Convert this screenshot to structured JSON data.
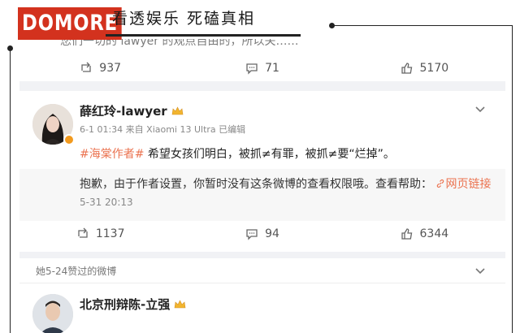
{
  "brand": {
    "logo": "DOMORE",
    "slogan": "看透娱乐  死磕真相"
  },
  "post_prev": {
    "cut_text": "您们一切的 lawyer 的观点自由的，所以关……",
    "reposts": "937",
    "comments": "71",
    "likes": "5170"
  },
  "post_main": {
    "author": "薛红玲-lawyer",
    "meta": "6-1 01:34 来自 Xiaomi 13 Ultra 已编辑",
    "hashtag": "#海棠作者#",
    "text": " 希望女孩们明白，被抓≠有罪，被抓≠要“烂掉”。",
    "inner_text": "抱歉，由于作者设置，你暂时没有这条微博的查看权限哦。查看帮助：",
    "inner_link": "网页链接",
    "inner_time": "5-31 20:13",
    "reposts": "1137",
    "comments": "94",
    "likes": "6344"
  },
  "post_next": {
    "section_label": "她5-24赞过的微博",
    "author": "北京刑辩陈-立强"
  },
  "colors": {
    "accent": "#eb7350",
    "brand_red": "#d3321e",
    "verify": "#f29a1e"
  },
  "icons": [
    "repost-icon",
    "comment-icon",
    "like-icon",
    "chevron-down-icon",
    "crown-icon",
    "link-icon",
    "verified-icon"
  ]
}
